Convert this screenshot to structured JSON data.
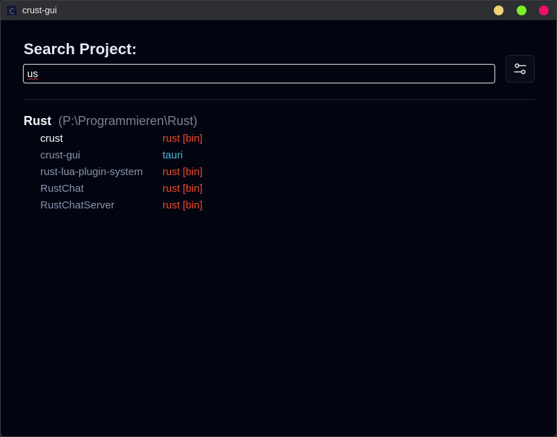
{
  "window": {
    "title": "crust-gui",
    "controls": {
      "minimize_color": "#f5d27a",
      "maximize_color": "#7bf02b",
      "close_color": "#f00f6a"
    }
  },
  "search": {
    "heading": "Search Project:",
    "value": "us",
    "filter_icon": "sliders-icon"
  },
  "colors": {
    "rust_type": "#ee4b2b",
    "tauri_type": "#4fb4d8",
    "accent_text": "#ffffff"
  },
  "results": {
    "group": {
      "name": "Rust",
      "path": "(P:\\Programmieren\\Rust)"
    },
    "items": [
      {
        "name": "crust",
        "type": "rust [bin]",
        "type_color": "#ee4b2b",
        "active": true
      },
      {
        "name": "crust-gui",
        "type": "tauri",
        "type_color": "#4fb4d8",
        "active": false
      },
      {
        "name": "rust-lua-plugin-system",
        "type": "rust [bin]",
        "type_color": "#ee4b2b",
        "active": false
      },
      {
        "name": "RustChat",
        "type": "rust [bin]",
        "type_color": "#ee4b2b",
        "active": false
      },
      {
        "name": "RustChatServer",
        "type": "rust [bin]",
        "type_color": "#ee4b2b",
        "active": false
      }
    ]
  }
}
